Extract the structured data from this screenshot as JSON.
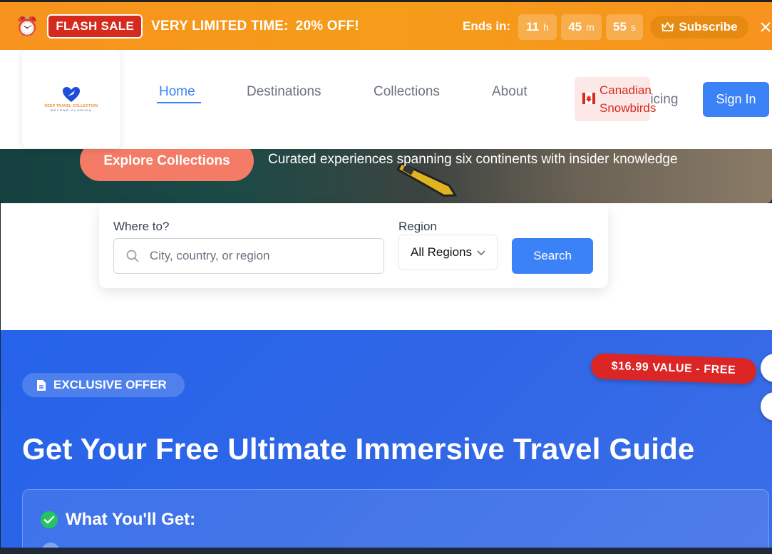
{
  "banner": {
    "alarm_icon": "⏰",
    "flash_label": "FLASH SALE",
    "limited_text": "VERY LIMITED TIME:",
    "discount_text": "20% OFF!",
    "ends_label": "Ends in:",
    "hours": "11",
    "hours_unit": "h",
    "minutes": "45",
    "minutes_unit": "m",
    "seconds": "55",
    "seconds_unit": "s",
    "subscribe_label": "Subscribe",
    "accent_color": "#f7931e"
  },
  "nav": {
    "logo_line1": "DEEP TRAVEL COLLECTION",
    "logo_line2": "BEYOND FLORIDA",
    "links": [
      {
        "label": "Home"
      },
      {
        "label": "Destinations"
      },
      {
        "label": "Collections"
      },
      {
        "label": "About"
      }
    ],
    "pricing_fragment": "ricing",
    "canadian_line1": "Canadian",
    "canadian_line2": "Snowbirds",
    "signin_label": "Sign In"
  },
  "hero": {
    "explore_label": "Explore Collections",
    "tagline": "Curated experiences spanning six continents with insider knowledge"
  },
  "search": {
    "where_label": "Where to?",
    "where_placeholder": "City, country, or region",
    "region_label": "Region",
    "region_value": "All Regions",
    "search_label": "Search"
  },
  "offer": {
    "badge_label": "EXCLUSIVE OFFER",
    "value_tag": "$16.99 VALUE - FREE",
    "title": "Get Your Free Ultimate Immersive Travel Guide",
    "what_title": "What You'll Get:"
  }
}
